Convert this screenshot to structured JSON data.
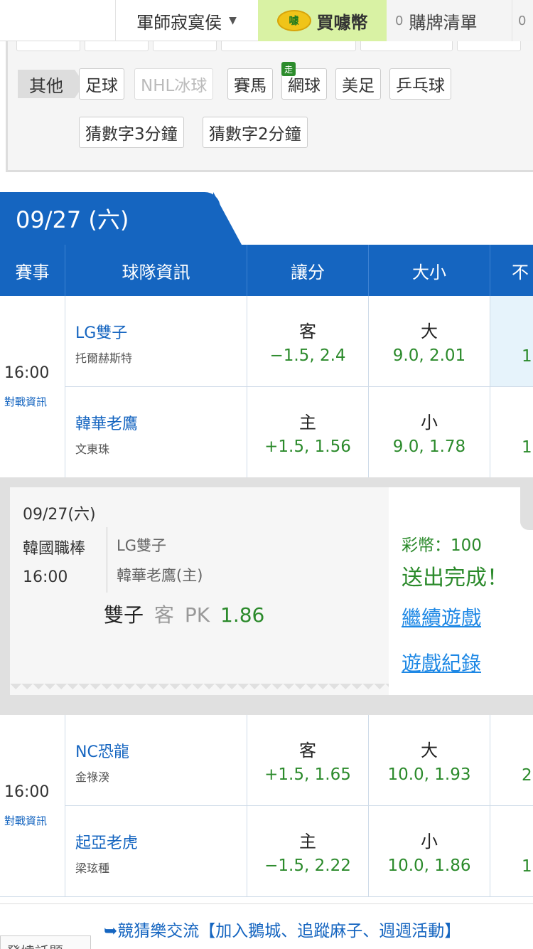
{
  "topbar": {
    "user_name": "軍師寂寞侯",
    "buy_coin_label": "買噱幣",
    "coin_icon_text": "噱",
    "cart_count": "0",
    "cart_label": "購牌清單",
    "cart2_count": "0"
  },
  "categories": {
    "other_label": "其他",
    "chips": [
      {
        "label": "足球"
      },
      {
        "label": "NHL冰球"
      },
      {
        "label": "賽馬"
      },
      {
        "label": "網球"
      },
      {
        "label": "美足"
      },
      {
        "label": "乒乓球"
      },
      {
        "label": "猜數字3分鐘"
      },
      {
        "label": "猜數字2分鐘"
      }
    ],
    "walk_badge": "走"
  },
  "date_tab": "09/27 (六)",
  "table_header": {
    "event": "賽事",
    "team_info": "球隊資訊",
    "spread": "讓分",
    "total": "大小",
    "edge": "不"
  },
  "matches": [
    {
      "time": "16:00",
      "h2h_label": "對戰資訊",
      "away": {
        "name": "LG雙子",
        "pitcher": "托爾赫斯特",
        "spread_side": "客",
        "spread_val": "−1.5, 2.4",
        "total_side": "大",
        "total_val": "9.0, 2.01",
        "edge_frag": "1."
      },
      "home": {
        "name": "韓華老鷹",
        "pitcher": "文東珠",
        "spread_side": "主",
        "spread_val": "+1.5, 1.56",
        "total_side": "小",
        "total_val": "9.0, 1.78",
        "edge_frag": "1"
      }
    },
    {
      "time": "16:00",
      "h2h_label": "對戰資訊",
      "away": {
        "name": "NC恐龍",
        "pitcher": "金祿湀",
        "spread_side": "客",
        "spread_val": "+1.5, 1.65",
        "total_side": "大",
        "total_val": "10.0, 1.93",
        "edge_frag": "2"
      },
      "home": {
        "name": "起亞老虎",
        "pitcher": "梁玹種",
        "spread_side": "主",
        "spread_val": "−1.5, 2.22",
        "total_side": "小",
        "total_val": "10.0, 1.86",
        "edge_frag": "1."
      }
    }
  ],
  "ticket": {
    "date": "09/27(六)",
    "league": "韓國職棒",
    "time": "16:00",
    "away": "LG雙子",
    "home": "韓華老鷹(主)",
    "pick_team": "雙子",
    "pick_side": "客",
    "pick_type": "PK",
    "pick_odds": "1.86",
    "coins": "彩幣：100",
    "done": "送出完成！",
    "continue": "繼續遊戲",
    "history": "遊戲紀錄"
  },
  "footer": {
    "hot_topics": "發燒話題",
    "notice": "➥競猜樂交流【加入鵝城、追蹤麻子、週週活動】"
  }
}
